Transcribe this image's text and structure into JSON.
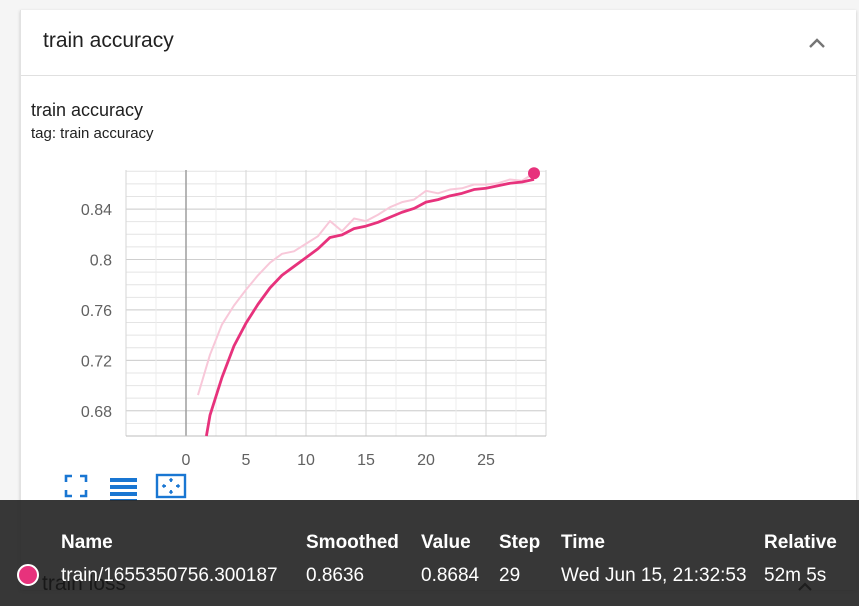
{
  "card": {
    "title": "train accuracy"
  },
  "chart_panel": {
    "title": "train accuracy",
    "tag": "tag: train accuracy"
  },
  "chart_data": {
    "type": "line",
    "xlim": [
      -5,
      30
    ],
    "ylim": [
      0.66,
      0.871
    ],
    "x_ticks": [
      0,
      5,
      10,
      15,
      20,
      25
    ],
    "y_ticks": [
      0.68,
      0.72,
      0.76,
      0.8,
      0.84
    ],
    "grid": true,
    "colors": {
      "raw": "#f8c8d9",
      "smoothed": "#e7327c"
    },
    "series": [
      {
        "points": [
          [
            1,
            0.6925
          ],
          [
            2,
            0.7245
          ],
          [
            3,
            0.7485
          ],
          [
            4,
            0.7635
          ],
          [
            5,
            0.776
          ],
          [
            6,
            0.7875
          ],
          [
            7,
            0.7975
          ],
          [
            8,
            0.8045
          ],
          [
            9,
            0.8065
          ],
          [
            10,
            0.8125
          ],
          [
            11,
            0.8185
          ],
          [
            12,
            0.8305
          ],
          [
            13,
            0.8225
          ],
          [
            14,
            0.8325
          ],
          [
            15,
            0.8305
          ],
          [
            16,
            0.8355
          ],
          [
            17,
            0.8415
          ],
          [
            18,
            0.8455
          ],
          [
            19,
            0.8475
          ],
          [
            20,
            0.8545
          ],
          [
            21,
            0.8525
          ],
          [
            22,
            0.8555
          ],
          [
            23,
            0.8565
          ],
          [
            24,
            0.8595
          ],
          [
            25,
            0.8595
          ],
          [
            26,
            0.8605
          ],
          [
            27,
            0.8635
          ],
          [
            28,
            0.8625
          ],
          [
            29,
            0.8684
          ]
        ]
      },
      {
        "points": [
          [
            1.7,
            0.66
          ],
          [
            2,
            0.6765
          ],
          [
            3,
            0.7065
          ],
          [
            4,
            0.7315
          ],
          [
            5,
            0.7495
          ],
          [
            6,
            0.7645
          ],
          [
            7,
            0.7775
          ],
          [
            8,
            0.7875
          ],
          [
            9,
            0.7945
          ],
          [
            10,
            0.8015
          ],
          [
            11,
            0.8085
          ],
          [
            12,
            0.8175
          ],
          [
            13,
            0.8195
          ],
          [
            14,
            0.8245
          ],
          [
            15,
            0.8265
          ],
          [
            16,
            0.8295
          ],
          [
            17,
            0.8335
          ],
          [
            18,
            0.8375
          ],
          [
            19,
            0.8405
          ],
          [
            20,
            0.8455
          ],
          [
            21,
            0.8475
          ],
          [
            22,
            0.8505
          ],
          [
            23,
            0.8525
          ],
          [
            24,
            0.8555
          ],
          [
            25,
            0.8565
          ],
          [
            26,
            0.8585
          ],
          [
            27,
            0.8605
          ],
          [
            28,
            0.8615
          ],
          [
            29,
            0.8636
          ]
        ]
      }
    ]
  },
  "tooltip": {
    "headers": {
      "name": "Name",
      "smoothed": "Smoothed",
      "value": "Value",
      "step": "Step",
      "time": "Time",
      "relative": "Relative"
    },
    "row": {
      "name": "train/1655350756.300187",
      "smoothed": "0.8636",
      "value": "0.8684",
      "step": "29",
      "time": "Wed Jun 15, 21:32:53",
      "relative": "52m 5s",
      "color": "#e7327c"
    }
  },
  "next_card": {
    "title": "train loss"
  },
  "icons": {
    "collapse": "chevron-up-icon",
    "fit_domain": "fullscreen-icon",
    "log_scale": "lines-icon",
    "fit_to_data": "fit-data-icon"
  }
}
